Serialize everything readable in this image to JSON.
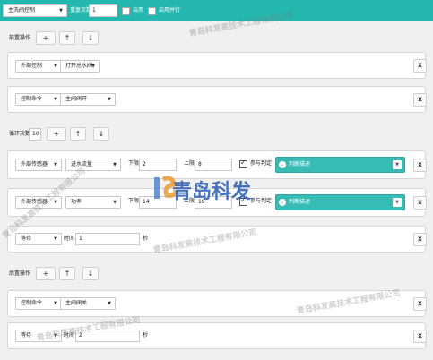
{
  "top": {
    "valve_select": "主洗阀控制",
    "repeat_label": "重复次数",
    "repeat_value": "1",
    "enable_label": "启用",
    "parallel_label": "启用并行"
  },
  "pre": {
    "title": "前置操作",
    "add": "+",
    "up": "↑",
    "down": "↓",
    "row1": {
      "type": "外部控制",
      "action": "打开总水阀",
      "close": "X"
    },
    "row2": {
      "type": "控制命令",
      "action": "主阀阀开",
      "close": "X"
    }
  },
  "loop": {
    "count_label": "循环次数",
    "count_value": "10",
    "add": "+",
    "up": "↑",
    "down": "↓",
    "row1": {
      "type": "外部传感器",
      "sensor": "进水流量",
      "lower_label": "下限",
      "lower_value": "2",
      "upper_label": "上限",
      "upper_value": "8",
      "judge_label": "参与判定",
      "judge_select": "判断描述",
      "close": "X"
    },
    "row2": {
      "type": "外部传感器",
      "sensor": "功率",
      "lower_label": "下限",
      "lower_value": "14",
      "upper_label": "上限",
      "upper_value": "18",
      "judge_label": "参与判定",
      "judge_select": "判断描述",
      "close": "X"
    },
    "row3": {
      "type": "等待",
      "time_label": "时间",
      "time_value": "1",
      "unit": "秒",
      "close": "X"
    }
  },
  "post": {
    "title": "后置操作",
    "add": "+",
    "up": "↑",
    "down": "↓",
    "row1": {
      "type": "控制命令",
      "action": "主阀阀关",
      "close": "X"
    },
    "row2": {
      "type": "等待",
      "time_label": "时间",
      "time_value": "2",
      "unit": "秒",
      "close": "X"
    }
  },
  "watermark": {
    "logo_text": "青岛科发",
    "company": "青岛科发高技术工程有限公司"
  },
  "colors": {
    "accent": "#24b7b0",
    "teal_select": "#38bbb5"
  }
}
